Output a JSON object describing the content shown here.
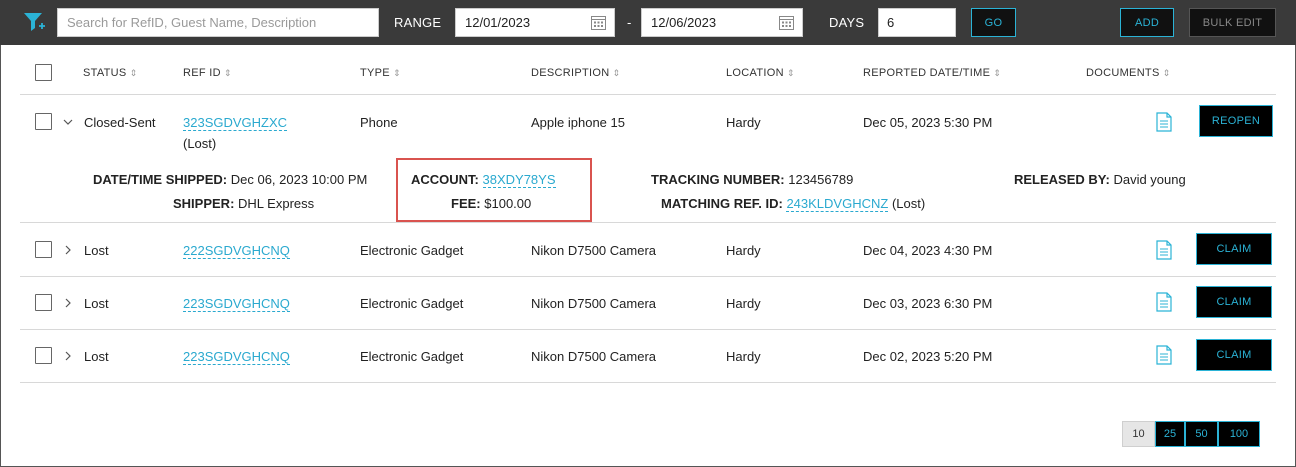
{
  "toolbar": {
    "search_placeholder": "Search for RefID, Guest Name, Description",
    "range_label": "RANGE",
    "date_from": "12/01/2023",
    "date_separator": "-",
    "date_to": "12/06/2023",
    "days_label": "DAYS",
    "days_value": "6",
    "go_label": "GO",
    "add_label": "ADD",
    "bulk_edit_label": "BULK EDIT",
    "accent_color": "#2bb3d6"
  },
  "table": {
    "headers": {
      "status": "STATUS",
      "ref_id": "REF ID",
      "type": "TYPE",
      "description": "DESCRIPTION",
      "location": "LOCATION",
      "reported": "REPORTED DATE/TIME",
      "documents": "DOCUMENTS"
    },
    "sort_glyph": "⇕",
    "rows": [
      {
        "status": "Closed-Sent",
        "ref_id": "323SGDVGHZXC",
        "ref_sub": "(Lost)",
        "type": "Phone",
        "description": "Apple iphone 15",
        "location": "Hardy",
        "reported": "Dec 05, 2023 5:30 PM",
        "action": "REOPEN",
        "expanded": true
      },
      {
        "status": "Lost",
        "ref_id": "222SGDVGHCNQ",
        "type": "Electronic Gadget",
        "description": "Nikon D7500 Camera",
        "location": "Hardy",
        "reported": "Dec 04, 2023 4:30 PM",
        "action": "CLAIM"
      },
      {
        "status": "Lost",
        "ref_id": "223SGDVGHCNQ",
        "type": "Electronic Gadget",
        "description": "Nikon D7500 Camera",
        "location": "Hardy",
        "reported": "Dec 03, 2023 6:30 PM",
        "action": "CLAIM"
      },
      {
        "status": "Lost",
        "ref_id": "223SGDVGHCNQ",
        "type": "Electronic Gadget",
        "description": "Nikon D7500 Camera",
        "location": "Hardy",
        "reported": "Dec 02, 2023 5:20 PM",
        "action": "CLAIM"
      }
    ]
  },
  "details": {
    "shipped_label": "DATE/TIME SHIPPED:",
    "shipped_value": "Dec 06, 2023 10:00 PM",
    "shipper_label": "SHIPPER:",
    "shipper_value": "DHL Express",
    "account_label": "ACCOUNT:",
    "account_value": "38XDY78YS",
    "fee_label": "FEE:",
    "fee_value": "$100.00",
    "tracking_label": "TRACKING NUMBER:",
    "tracking_value": "123456789",
    "matching_label": "MATCHING REF. ID:",
    "matching_value": "243KLDVGHCNZ",
    "matching_sub": "(Lost)",
    "released_label": "RELEASED BY:",
    "released_value": "David young"
  },
  "pagination": {
    "options": [
      "10",
      "25",
      "50",
      "100"
    ],
    "selected": "10"
  }
}
